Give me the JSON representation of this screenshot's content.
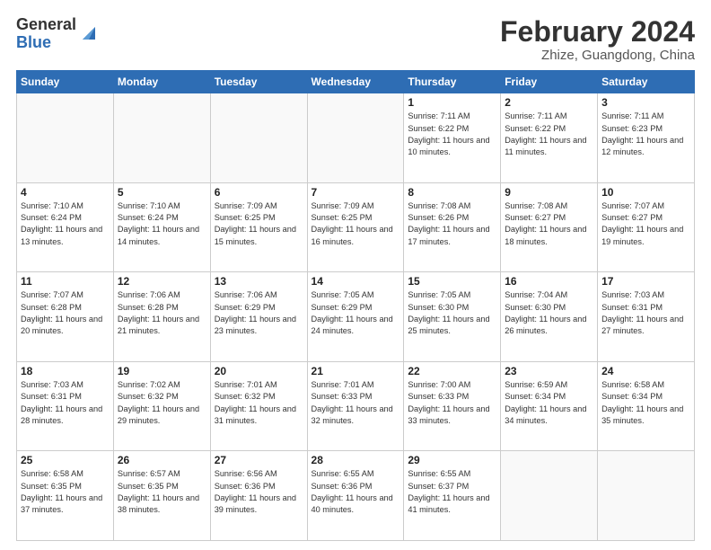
{
  "logo": {
    "general": "General",
    "blue": "Blue"
  },
  "header": {
    "month": "February 2024",
    "location": "Zhize, Guangdong, China"
  },
  "days_of_week": [
    "Sunday",
    "Monday",
    "Tuesday",
    "Wednesday",
    "Thursday",
    "Friday",
    "Saturday"
  ],
  "weeks": [
    [
      {
        "day": "",
        "sunrise": "",
        "sunset": "",
        "daylight": ""
      },
      {
        "day": "",
        "sunrise": "",
        "sunset": "",
        "daylight": ""
      },
      {
        "day": "",
        "sunrise": "",
        "sunset": "",
        "daylight": ""
      },
      {
        "day": "",
        "sunrise": "",
        "sunset": "",
        "daylight": ""
      },
      {
        "day": "1",
        "sunrise": "Sunrise: 7:11 AM",
        "sunset": "Sunset: 6:22 PM",
        "daylight": "Daylight: 11 hours and 10 minutes."
      },
      {
        "day": "2",
        "sunrise": "Sunrise: 7:11 AM",
        "sunset": "Sunset: 6:22 PM",
        "daylight": "Daylight: 11 hours and 11 minutes."
      },
      {
        "day": "3",
        "sunrise": "Sunrise: 7:11 AM",
        "sunset": "Sunset: 6:23 PM",
        "daylight": "Daylight: 11 hours and 12 minutes."
      }
    ],
    [
      {
        "day": "4",
        "sunrise": "Sunrise: 7:10 AM",
        "sunset": "Sunset: 6:24 PM",
        "daylight": "Daylight: 11 hours and 13 minutes."
      },
      {
        "day": "5",
        "sunrise": "Sunrise: 7:10 AM",
        "sunset": "Sunset: 6:24 PM",
        "daylight": "Daylight: 11 hours and 14 minutes."
      },
      {
        "day": "6",
        "sunrise": "Sunrise: 7:09 AM",
        "sunset": "Sunset: 6:25 PM",
        "daylight": "Daylight: 11 hours and 15 minutes."
      },
      {
        "day": "7",
        "sunrise": "Sunrise: 7:09 AM",
        "sunset": "Sunset: 6:25 PM",
        "daylight": "Daylight: 11 hours and 16 minutes."
      },
      {
        "day": "8",
        "sunrise": "Sunrise: 7:08 AM",
        "sunset": "Sunset: 6:26 PM",
        "daylight": "Daylight: 11 hours and 17 minutes."
      },
      {
        "day": "9",
        "sunrise": "Sunrise: 7:08 AM",
        "sunset": "Sunset: 6:27 PM",
        "daylight": "Daylight: 11 hours and 18 minutes."
      },
      {
        "day": "10",
        "sunrise": "Sunrise: 7:07 AM",
        "sunset": "Sunset: 6:27 PM",
        "daylight": "Daylight: 11 hours and 19 minutes."
      }
    ],
    [
      {
        "day": "11",
        "sunrise": "Sunrise: 7:07 AM",
        "sunset": "Sunset: 6:28 PM",
        "daylight": "Daylight: 11 hours and 20 minutes."
      },
      {
        "day": "12",
        "sunrise": "Sunrise: 7:06 AM",
        "sunset": "Sunset: 6:28 PM",
        "daylight": "Daylight: 11 hours and 21 minutes."
      },
      {
        "day": "13",
        "sunrise": "Sunrise: 7:06 AM",
        "sunset": "Sunset: 6:29 PM",
        "daylight": "Daylight: 11 hours and 23 minutes."
      },
      {
        "day": "14",
        "sunrise": "Sunrise: 7:05 AM",
        "sunset": "Sunset: 6:29 PM",
        "daylight": "Daylight: 11 hours and 24 minutes."
      },
      {
        "day": "15",
        "sunrise": "Sunrise: 7:05 AM",
        "sunset": "Sunset: 6:30 PM",
        "daylight": "Daylight: 11 hours and 25 minutes."
      },
      {
        "day": "16",
        "sunrise": "Sunrise: 7:04 AM",
        "sunset": "Sunset: 6:30 PM",
        "daylight": "Daylight: 11 hours and 26 minutes."
      },
      {
        "day": "17",
        "sunrise": "Sunrise: 7:03 AM",
        "sunset": "Sunset: 6:31 PM",
        "daylight": "Daylight: 11 hours and 27 minutes."
      }
    ],
    [
      {
        "day": "18",
        "sunrise": "Sunrise: 7:03 AM",
        "sunset": "Sunset: 6:31 PM",
        "daylight": "Daylight: 11 hours and 28 minutes."
      },
      {
        "day": "19",
        "sunrise": "Sunrise: 7:02 AM",
        "sunset": "Sunset: 6:32 PM",
        "daylight": "Daylight: 11 hours and 29 minutes."
      },
      {
        "day": "20",
        "sunrise": "Sunrise: 7:01 AM",
        "sunset": "Sunset: 6:32 PM",
        "daylight": "Daylight: 11 hours and 31 minutes."
      },
      {
        "day": "21",
        "sunrise": "Sunrise: 7:01 AM",
        "sunset": "Sunset: 6:33 PM",
        "daylight": "Daylight: 11 hours and 32 minutes."
      },
      {
        "day": "22",
        "sunrise": "Sunrise: 7:00 AM",
        "sunset": "Sunset: 6:33 PM",
        "daylight": "Daylight: 11 hours and 33 minutes."
      },
      {
        "day": "23",
        "sunrise": "Sunrise: 6:59 AM",
        "sunset": "Sunset: 6:34 PM",
        "daylight": "Daylight: 11 hours and 34 minutes."
      },
      {
        "day": "24",
        "sunrise": "Sunrise: 6:58 AM",
        "sunset": "Sunset: 6:34 PM",
        "daylight": "Daylight: 11 hours and 35 minutes."
      }
    ],
    [
      {
        "day": "25",
        "sunrise": "Sunrise: 6:58 AM",
        "sunset": "Sunset: 6:35 PM",
        "daylight": "Daylight: 11 hours and 37 minutes."
      },
      {
        "day": "26",
        "sunrise": "Sunrise: 6:57 AM",
        "sunset": "Sunset: 6:35 PM",
        "daylight": "Daylight: 11 hours and 38 minutes."
      },
      {
        "day": "27",
        "sunrise": "Sunrise: 6:56 AM",
        "sunset": "Sunset: 6:36 PM",
        "daylight": "Daylight: 11 hours and 39 minutes."
      },
      {
        "day": "28",
        "sunrise": "Sunrise: 6:55 AM",
        "sunset": "Sunset: 6:36 PM",
        "daylight": "Daylight: 11 hours and 40 minutes."
      },
      {
        "day": "29",
        "sunrise": "Sunrise: 6:55 AM",
        "sunset": "Sunset: 6:37 PM",
        "daylight": "Daylight: 11 hours and 41 minutes."
      },
      {
        "day": "",
        "sunrise": "",
        "sunset": "",
        "daylight": ""
      },
      {
        "day": "",
        "sunrise": "",
        "sunset": "",
        "daylight": ""
      }
    ]
  ]
}
